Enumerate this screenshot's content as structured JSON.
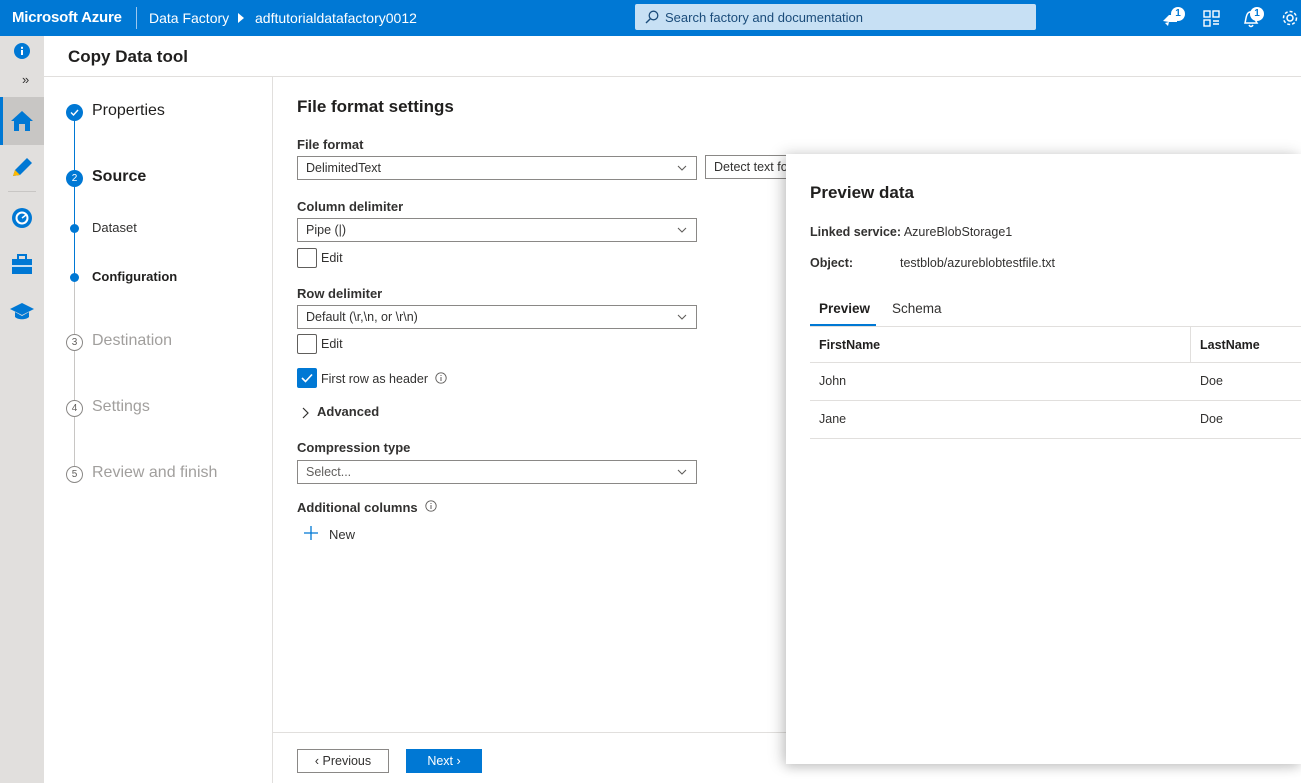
{
  "topbar": {
    "brand": "Microsoft Azure",
    "breadcrumb": [
      "Data Factory",
      "adftutorialdatafactory0012"
    ],
    "search_placeholder": "Search factory and documentation",
    "icons": [
      {
        "name": "feedback-icon",
        "badge": "1"
      },
      {
        "name": "switch-directory-icon",
        "badge": ""
      },
      {
        "name": "notifications-icon",
        "badge": "1"
      },
      {
        "name": "settings-icon",
        "badge": ""
      }
    ]
  },
  "rail": {
    "expand_label": "»",
    "items": [
      "home-icon",
      "author-icon",
      "monitor-icon",
      "manage-icon",
      "learning-icon"
    ]
  },
  "header": {
    "title": "Copy Data tool"
  },
  "wizard": {
    "steps": [
      {
        "number": "",
        "label": "Properties",
        "state": "done"
      },
      {
        "number": "2",
        "label": "Source",
        "state": "active",
        "substeps": [
          "Dataset",
          "Configuration"
        ]
      },
      {
        "number": "3",
        "label": "Destination",
        "state": "todo"
      },
      {
        "number": "4",
        "label": "Settings",
        "state": "todo"
      },
      {
        "number": "5",
        "label": "Review and finish",
        "state": "todo"
      }
    ]
  },
  "form": {
    "title": "File format settings",
    "file_format_label": "File format",
    "file_format_value": "DelimitedText",
    "detect_button": "Detect text format",
    "column_delimiter_label": "Column delimiter",
    "column_delimiter_value": "Pipe (|)",
    "column_edit_label": "Edit",
    "row_delimiter_label": "Row delimiter",
    "row_delimiter_value": "Default (\\r,\\n, or \\r\\n)",
    "row_edit_label": "Edit",
    "first_row_header_label": "First row as header",
    "first_row_header_checked": true,
    "advanced_label": "Advanced",
    "compression_label": "Compression type",
    "compression_placeholder": "Select...",
    "additional_columns_label": "Additional columns",
    "new_label": "New"
  },
  "footer": {
    "previous": "Previous",
    "next": "Next"
  },
  "preview": {
    "title": "Preview data",
    "linked_service_key": "Linked service:",
    "linked_service_value": "AzureBlobStorage1",
    "object_key": "Object:",
    "object_value": "testblob/azureblobtestfile.txt",
    "tabs": [
      "Preview",
      "Schema"
    ],
    "columns": [
      "FirstName",
      "LastName"
    ],
    "rows": [
      [
        "John",
        "Doe"
      ],
      [
        "Jane",
        "Doe"
      ]
    ]
  },
  "colors": {
    "accent": "#0078d4",
    "topbar": "#0078d4",
    "rail": "#e1dfdd"
  }
}
